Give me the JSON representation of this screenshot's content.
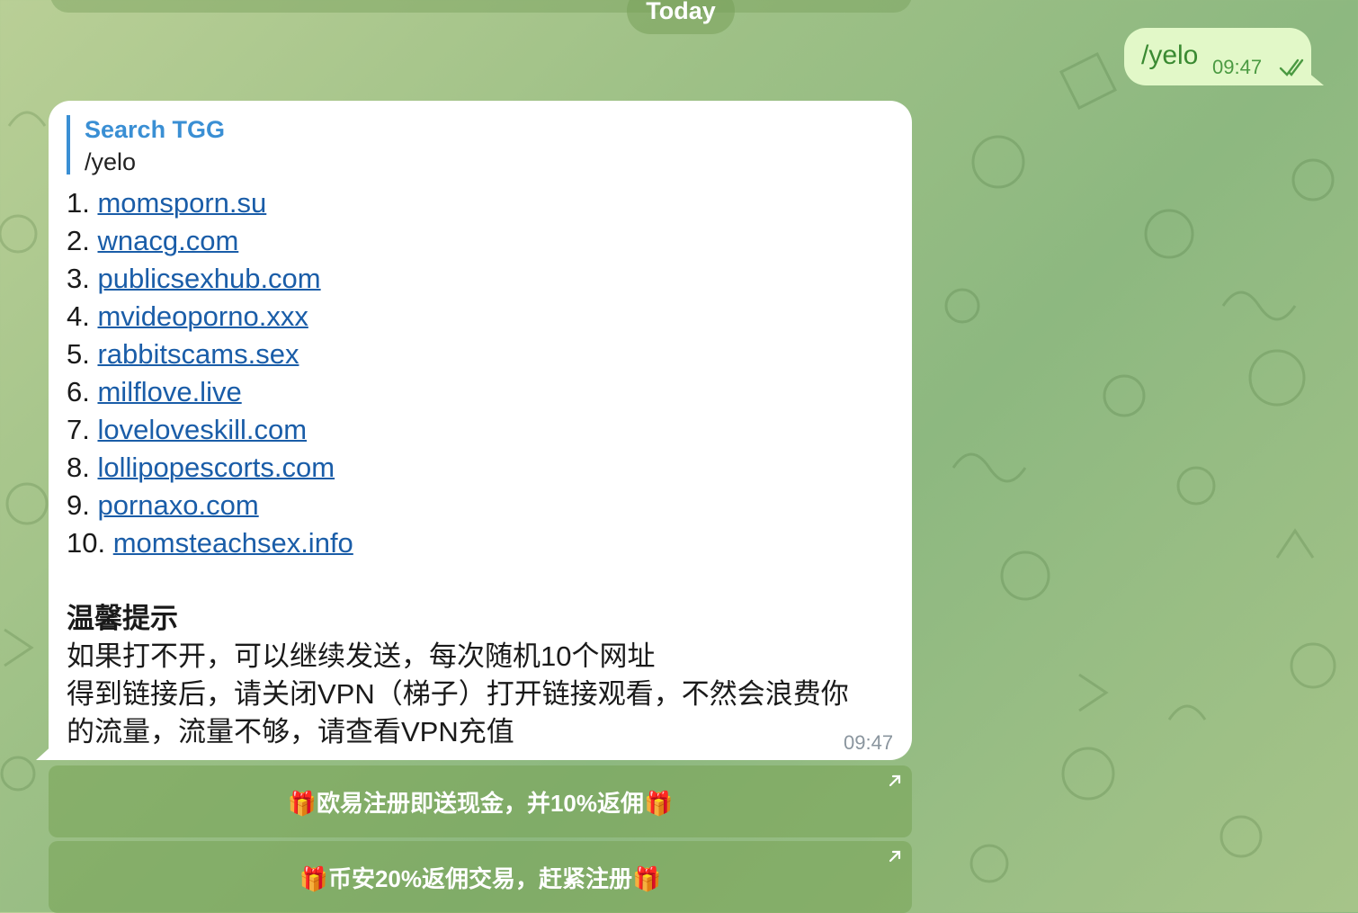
{
  "chat": {
    "date_separator": "Today"
  },
  "outgoing": {
    "text": "/yelo",
    "time": "09:47",
    "status": "read"
  },
  "incoming": {
    "reply_to": {
      "sender": "Search TGG",
      "text": "/yelo"
    },
    "links": [
      {
        "num": "1.",
        "url": "momsporn.su"
      },
      {
        "num": "2.",
        "url": "wnacg.com"
      },
      {
        "num": "3.",
        "url": "publicsexhub.com"
      },
      {
        "num": "4.",
        "url": "mvideoporno.xxx"
      },
      {
        "num": "5.",
        "url": "rabbitscams.sex"
      },
      {
        "num": "6.",
        "url": "milflove.live"
      },
      {
        "num": "7.",
        "url": "loveloveskill.com"
      },
      {
        "num": "8.",
        "url": "lollipopescorts.com"
      },
      {
        "num": "9.",
        "url": "pornaxo.com"
      },
      {
        "num": "10.",
        "url": "momsteachsex.info"
      }
    ],
    "tips_title": "温馨提示",
    "tips_lines": [
      "如果打不开，可以继续发送，每次随机10个网址",
      "得到链接后，请关闭VPN（梯子）打开链接观看，不然会浪费你",
      "的流量，流量不够，请查看VPN充值"
    ],
    "time": "09:47"
  },
  "keyboard": {
    "buttons": [
      {
        "label": "🎁欧易注册即送现金，并10%返佣🎁"
      },
      {
        "label": "🎁币安20%返佣交易，赶紧注册🎁"
      }
    ]
  },
  "colors": {
    "link": "#1a5da8",
    "reply_accent": "#3a8fd4",
    "outgoing_bubble": "#e2f8c8",
    "outgoing_text": "#3a8a32"
  }
}
